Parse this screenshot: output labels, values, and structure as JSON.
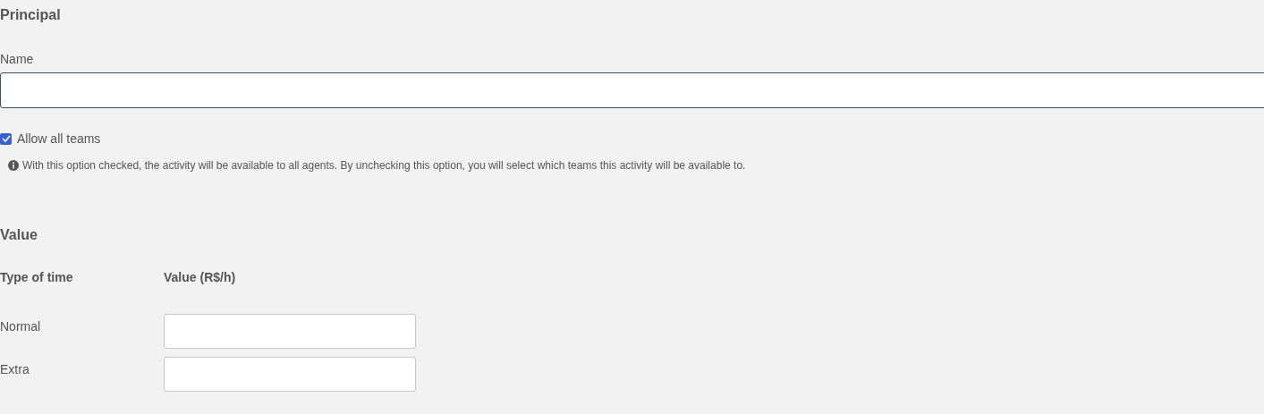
{
  "principal": {
    "title": "Principal",
    "name_field": {
      "label": "Name",
      "focused": true
    },
    "allow_all_teams": {
      "label": "Allow all teams",
      "checked": true
    },
    "info": "With this option checked, the activity will be available to all agents. By unchecking this option, you will select which teams this activity will be available to."
  },
  "value": {
    "title": "Value",
    "columns": [
      "Type of time",
      "Value (R$/h)"
    ],
    "rows": [
      {
        "label": "Normal"
      },
      {
        "label": "Extra"
      }
    ]
  }
}
